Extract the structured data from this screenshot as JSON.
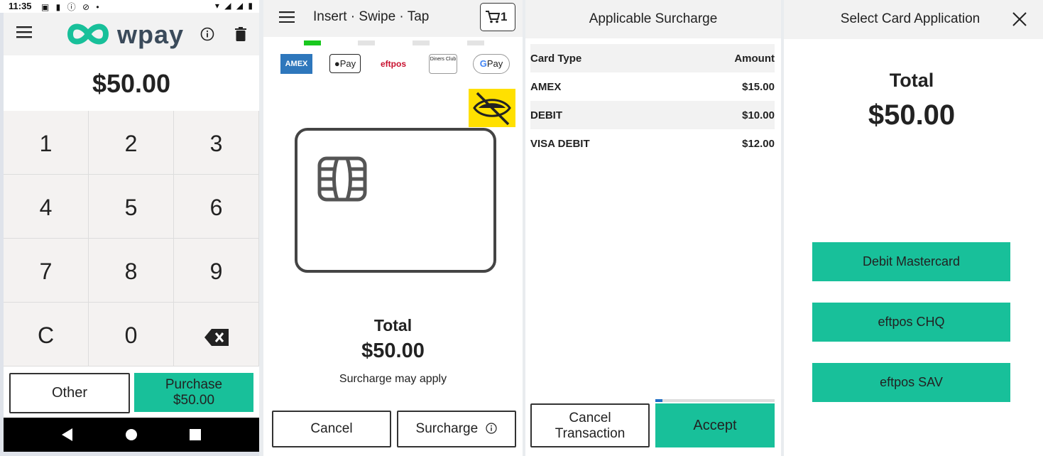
{
  "status_bar": {
    "time": "11:35"
  },
  "screen1": {
    "logo_text": "wpay",
    "amount": "$50.00",
    "keys": [
      "1",
      "2",
      "3",
      "4",
      "5",
      "6",
      "7",
      "8",
      "9",
      "C",
      "0"
    ],
    "other_label": "Other",
    "purchase_label": "Purchase",
    "purchase_amount": "$50.00"
  },
  "screen2": {
    "title": "Insert · Swipe · Tap",
    "cart_count": "1",
    "progress_active_step": 1,
    "progress_steps": 5,
    "logos": {
      "amex": "AMEX",
      "applepay": "Pay",
      "eftpos": "eftpos",
      "diners": "Diners Club",
      "gpay": "Pay"
    },
    "total_label": "Total",
    "total_amount": "$50.00",
    "surcharge_note": "Surcharge may apply",
    "cancel_label": "Cancel",
    "surcharge_label": "Surcharge"
  },
  "screen3": {
    "title": "Applicable Surcharge",
    "table": {
      "headers": [
        "Card Type",
        "Amount"
      ],
      "rows": [
        [
          "AMEX",
          "$15.00"
        ],
        [
          "DEBIT",
          "$10.00"
        ],
        [
          "VISA DEBIT",
          "$12.00"
        ]
      ]
    },
    "timer_progress_fraction": 0.06,
    "cancel_label_line1": "Cancel",
    "cancel_label_line2": "Transaction",
    "accept_label": "Accept"
  },
  "screen4": {
    "title": "Select Card Application",
    "total_label": "Total",
    "total_amount": "$50.00",
    "applications": [
      "Debit Mastercard",
      "eftpos CHQ",
      "eftpos SAV"
    ]
  },
  "colors": {
    "accent": "#18c09a",
    "privacy_yellow": "#ffe000",
    "progress_green": "#19c81e",
    "timer_blue": "#1f6fc6"
  }
}
